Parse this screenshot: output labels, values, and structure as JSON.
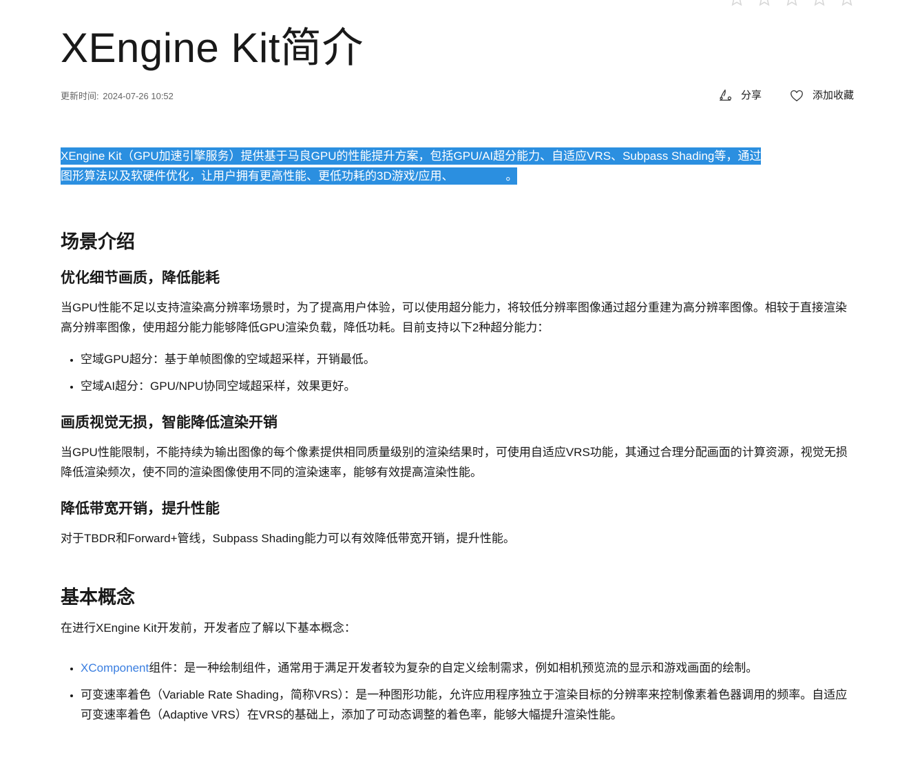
{
  "rating": {
    "stars": 5,
    "icon": "star-outline-icon",
    "color": "#d7d7d7"
  },
  "title": "XEngine Kit简介",
  "meta": {
    "updated_label": "更新时间:",
    "updated_value": "2024-07-26 10:52"
  },
  "actions": {
    "share_label": "分享",
    "share_icon": "share-icon",
    "favorite_label": "添加收藏",
    "favorite_icon": "heart-icon"
  },
  "intro": {
    "line1": "XEngine Kit（GPU加速引擎服务）提供基于马良GPU的性能提升方案，包括GPU/AI超分能力、自适应VRS、Subpass Shading等，通过",
    "line2": "图形算法以及软硬件优化，让用户拥有更高性能、更低功耗的3D游戏/应用、",
    "line2_end": "。",
    "highlight_color": "#2b8fe0"
  },
  "scenes": {
    "heading": "场景介绍",
    "section1": {
      "heading": "优化细节画质，降低能耗",
      "body": "当GPU性能不足以支持渲染高分辨率场景时，为了提高用户体验，可以使用超分能力，将较低分辨率图像通过超分重建为高分辨率图像。相较于直接渲染高分辨率图像，使用超分能力能够降低GPU渲染负载，降低功耗。目前支持以下2种超分能力：",
      "items": [
        "空域GPU超分：基于单帧图像的空域超采样，开销最低。",
        "空域AI超分：GPU/NPU协同空域超采样，效果更好。"
      ]
    },
    "section2": {
      "heading": "画质视觉无损，智能降低渲染开销",
      "body": "当GPU性能限制，不能持续为输出图像的每个像素提供相同质量级别的渲染结果时，可使用自适应VRS功能，其通过合理分配画面的计算资源，视觉无损降低渲染频次，使不同的渲染图像使用不同的渲染速率，能够有效提高渲染性能。"
    },
    "section3": {
      "heading": "降低带宽开销，提升性能",
      "body": "对于TBDR和Forward+管线，Subpass Shading能力可以有效降低带宽开销，提升性能。"
    }
  },
  "concepts": {
    "heading": "基本概念",
    "intro": "在进行XEngine Kit开发前，开发者应了解以下基本概念：",
    "item1_link": "XComponent",
    "item1_text": "组件：是一种绘制组件，通常用于满足开发者较为复杂的自定义绘制需求，例如相机预览流的显示和游戏画面的绘制。",
    "item2_text": "可变速率着色（Variable Rate Shading，简称VRS）：是一种图形功能，允许应用程序独立于渲染目标的分辨率来控制像素着色器调用的频率。自适应可变速率着色（Adaptive VRS）在VRS的基础上，添加了可动态调整的着色率，能够大幅提升渲染性能。",
    "link_color": "#3a7ee0"
  }
}
